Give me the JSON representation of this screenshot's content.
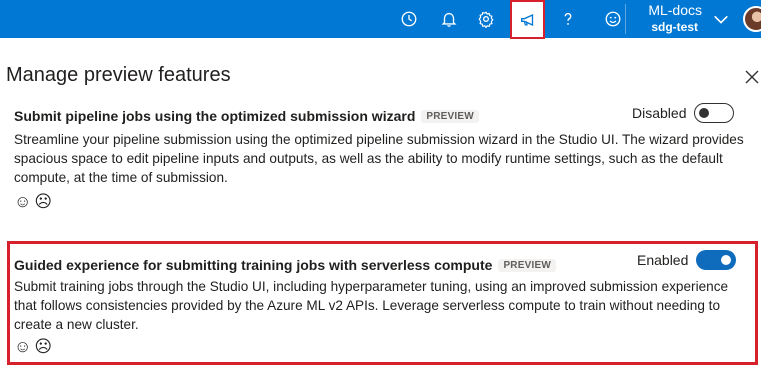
{
  "colors": {
    "topbar": "#0078d4",
    "highlight": "#d6202b",
    "toggle_on": "#0f6cbd"
  },
  "topbar": {
    "icons": [
      "clock-icon",
      "bell-icon",
      "gear-icon",
      "megaphone-icon",
      "help-icon",
      "smiley-icon"
    ],
    "account_name": "ML-docs",
    "workspace": "sdg-test"
  },
  "panel": {
    "title": "Manage preview features",
    "features": [
      {
        "title": "Submit pipeline jobs using the optimized submission wizard",
        "badge": "PREVIEW",
        "description": "Streamline your pipeline submission using the optimized pipeline submission wizard in the Studio UI. The wizard provides spacious space to edit pipeline inputs and outputs, as well as the ability to modify runtime settings, such as the default compute, at the time of submission.",
        "toggle_label": "Disabled",
        "enabled": false,
        "feedback": [
          "☺",
          "☹"
        ]
      },
      {
        "title": "Guided experience for submitting training jobs with serverless compute",
        "badge": "PREVIEW",
        "description": "Submit training jobs through the Studio UI, including hyperparameter tuning, using an improved submission experience that follows consistencies provided by the Azure ML v2 APIs. Leverage serverless compute to train without needing to create a new cluster.",
        "toggle_label": "Enabled",
        "enabled": true,
        "feedback": [
          "☺",
          "☹"
        ]
      }
    ]
  }
}
